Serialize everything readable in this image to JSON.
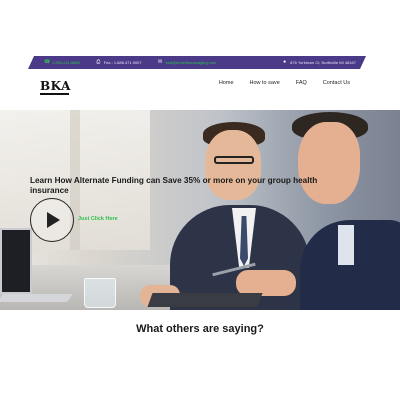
{
  "topbar": {
    "phone": "1.855.241.8880",
    "fax": "Fax.: 1.888.471.9007",
    "email": "bka@benefitsmanaging.com",
    "address": "876 Yorktown Ct, Northville MI 48167",
    "colors": {
      "bar": "#4a3a87",
      "accent": "#2fbf4f"
    },
    "icons": [
      "phone-icon",
      "fax-icon",
      "email-icon",
      "location-pin-icon"
    ]
  },
  "header": {
    "logo": "BKA",
    "nav": [
      "Home",
      "How to save",
      "FAQ",
      "Contact Us"
    ]
  },
  "hero": {
    "title": "Learn How Alternate Funding can Save 35% or more on your group health insurance",
    "cta": "Just Click Here",
    "play_icon": "play-icon"
  },
  "testimonials": {
    "heading": "What others are saying?"
  }
}
